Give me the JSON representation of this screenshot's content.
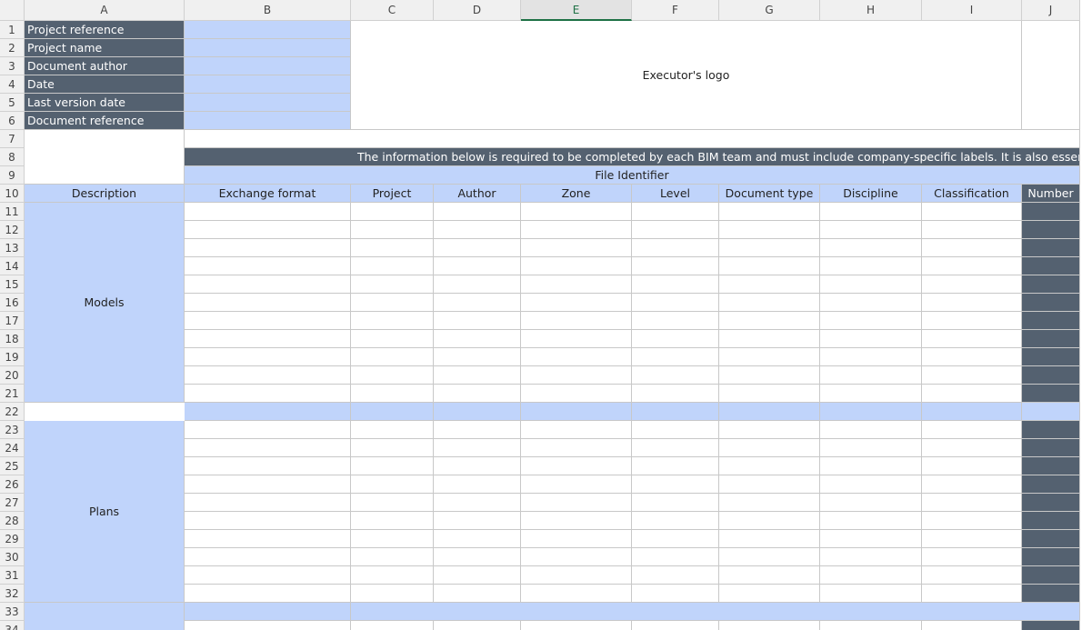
{
  "columns": [
    "A",
    "B",
    "C",
    "D",
    "E",
    "F",
    "G",
    "H",
    "I",
    "J"
  ],
  "selected_column": "E",
  "row_numbers": [
    1,
    2,
    3,
    4,
    5,
    6,
    7,
    8,
    9,
    10,
    11,
    12,
    13,
    14,
    15,
    16,
    17,
    18,
    19,
    20,
    21,
    22,
    23,
    24,
    25,
    26,
    27,
    28,
    29,
    30,
    31,
    32,
    33,
    34
  ],
  "info_labels": [
    "Project reference",
    "Project name",
    "Document author",
    "Date",
    "Last version date",
    "Document reference"
  ],
  "logo_placeholder": "Executor's logo",
  "notice": "The information below is required to be completed by each BIM team and must include company-specific labels. It is also essential to",
  "file_identifier": "File Identifier",
  "headers": [
    "Description",
    "Exchange format",
    "Project",
    "Author",
    "Zone",
    "Level",
    "Document type",
    "Discipline",
    "Classification",
    "Number"
  ],
  "sections": [
    "Models",
    "Plans"
  ],
  "colors": {
    "dark": "#546170",
    "light": "#c0d4fb"
  }
}
